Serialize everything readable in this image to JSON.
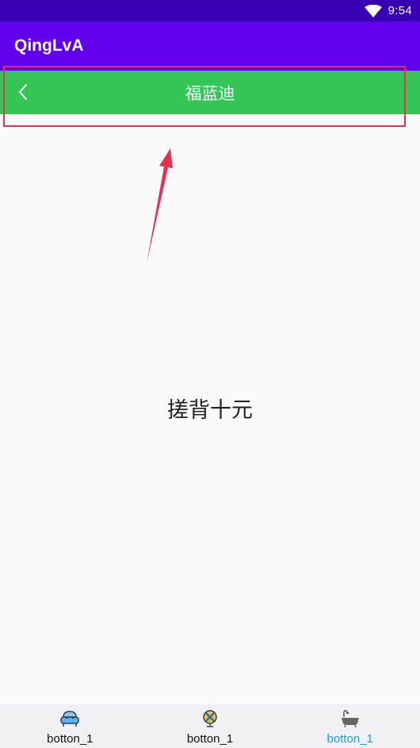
{
  "status_bar": {
    "time": "9:54",
    "wifi_icon": "wifi-icon"
  },
  "app_bar": {
    "title": "QingLvA"
  },
  "title_bar": {
    "back_icon": "back-chevron-icon",
    "title": "福蓝迪",
    "color": "#34c555"
  },
  "content": {
    "text": "搓背十元"
  },
  "bottom_nav": {
    "items": [
      {
        "label": "botton_1",
        "icon": "sofa-icon",
        "active": false
      },
      {
        "label": "botton_1",
        "icon": "globe-icon",
        "active": false
      },
      {
        "label": "botton_1",
        "icon": "bathtub-icon",
        "active": true
      }
    ],
    "active_color": "#1aa0d8"
  },
  "colors": {
    "status_bar": "#3700b3",
    "app_bar": "#6200ee",
    "annotation": "#e2324f"
  }
}
